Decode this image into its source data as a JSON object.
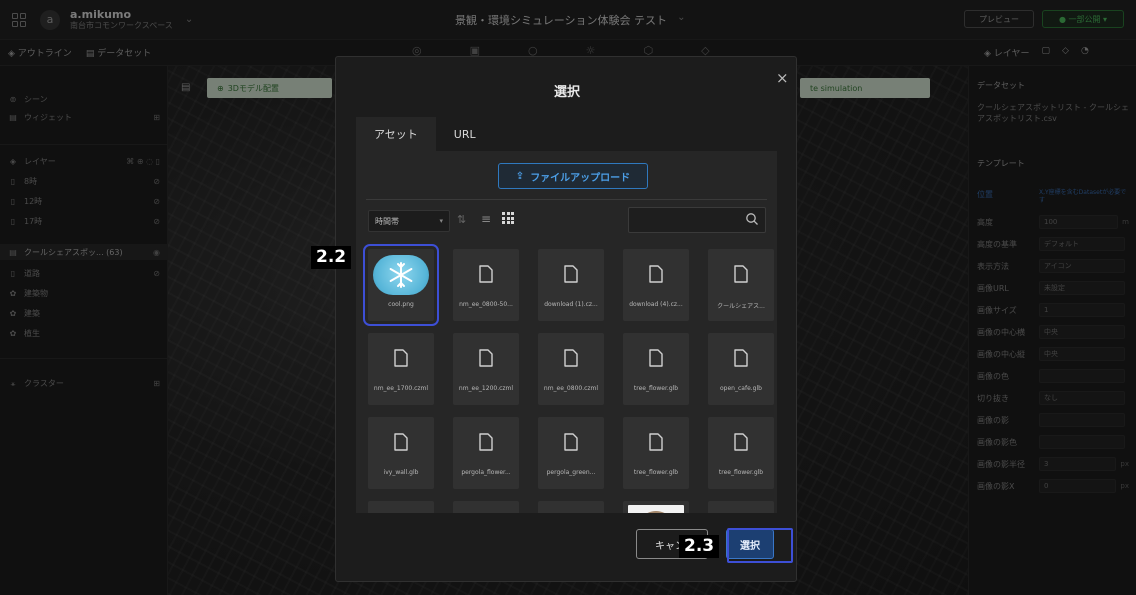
{
  "topbar": {
    "user": "a.mikumo",
    "workspace": "南台市コモンワークスペース",
    "avatar_letter": "a",
    "project_title": "景観・環境シミュレーション体験会 テスト",
    "preview_label": "プレビュー",
    "publish_label": "● 一部公開 ▾"
  },
  "subbar": {
    "outline_tab": "アウトライン",
    "dataset_tab": "データセット",
    "layer_tab": "レイヤー"
  },
  "map": {
    "pill_left": "3Dモデル配置",
    "pill_right": "te simulation"
  },
  "sidebar_left": {
    "scene": "シーン",
    "widget": "ウィジェット",
    "layer": "レイヤー",
    "items": [
      "8時",
      "12時",
      "17時",
      "クールシェアスポッ... (63)",
      "道路",
      "建築物",
      "建築",
      "植生"
    ],
    "cluster": "クラスター"
  },
  "sidebar_right": {
    "dataset_header": "データセット",
    "dataset_name": "クールシェアスポットリスト - クールシェアスポットリスト.csv",
    "template_header": "テンプレート",
    "location_label": "位置",
    "location_hint": "X,Y座標を含むDatasetが必要です",
    "rows": [
      {
        "label": "高度",
        "value": "100",
        "unit": "m"
      },
      {
        "label": "高度の基準",
        "value": "デフォルト",
        "unit": ""
      },
      {
        "label": "表示方法",
        "value": "アイコン",
        "unit": ""
      },
      {
        "label": "画像URL",
        "value": "未設定",
        "unit": ""
      },
      {
        "label": "画像サイズ",
        "value": "1",
        "unit": ""
      },
      {
        "label": "画像の中心横",
        "value": "中央",
        "unit": ""
      },
      {
        "label": "画像の中心縦",
        "value": "中央",
        "unit": ""
      },
      {
        "label": "画像の色",
        "value": "",
        "unit": ""
      },
      {
        "label": "切り抜き",
        "value": "なし",
        "unit": ""
      },
      {
        "label": "画像の影",
        "value": "",
        "unit": ""
      },
      {
        "label": "画像の影色",
        "value": "",
        "unit": ""
      },
      {
        "label": "画像の影半径",
        "value": "3",
        "unit": "px"
      },
      {
        "label": "画像の影X",
        "value": "0",
        "unit": "px"
      }
    ]
  },
  "modal": {
    "title": "選択",
    "close_label": "×",
    "tabs": [
      "アセット",
      "URL"
    ],
    "upload_label": "ファイルアップロード",
    "filter_label": "時間帯",
    "search_placeholder": "",
    "files_row1": [
      "cool.png",
      "nm_ee_0800-50...",
      "download (1).cz...",
      "download (4).cz...",
      "クールシェアス..."
    ],
    "files_row2": [
      "nm_ee_1700.czml",
      "nm_ee_1200.czml",
      "nm_ee_0800.czml",
      "tree_flower.glb",
      "open_cafe.glb"
    ],
    "files_row3": [
      "ivy_wall.glb",
      "pergola_flower...",
      "pergola_green...",
      "tree_flower.glb",
      "tree_flower.glb"
    ],
    "cancel_label": "キャンセル",
    "select_label": "選択"
  },
  "annotations": {
    "step_a": "2.2",
    "step_b": "2.3"
  },
  "colors": {
    "accent_blue": "#2f79bf",
    "highlight_outline": "#3d4fd6",
    "publish_green": "#4fbf60"
  }
}
